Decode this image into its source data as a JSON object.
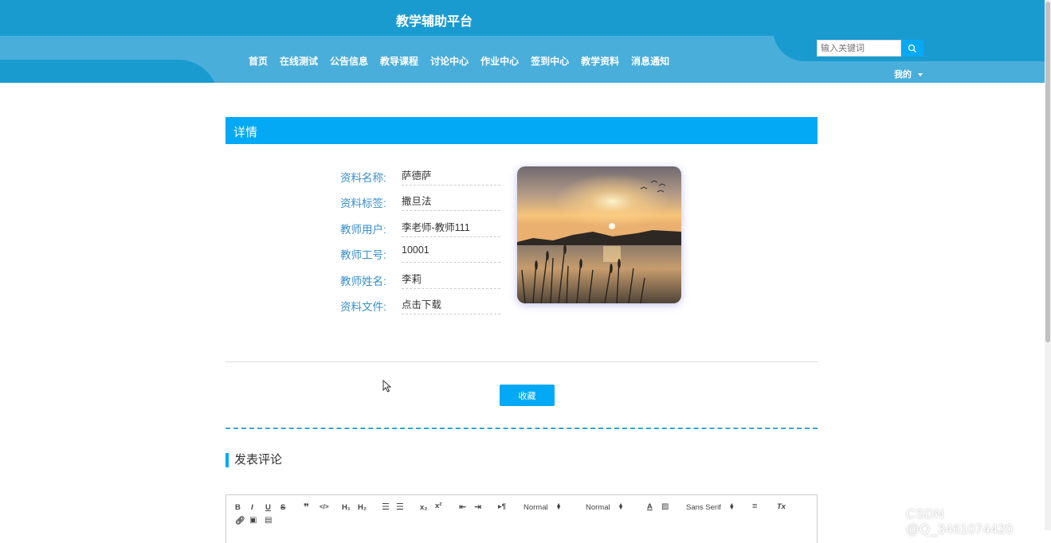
{
  "header": {
    "title": "教学辅助平台",
    "nav": [
      "首页",
      "在线测试",
      "公告信息",
      "教导课程",
      "讨论中心",
      "作业中心",
      "签到中心",
      "教学资料",
      "消息通知"
    ],
    "search_placeholder": "输入关键词",
    "user_menu": "我的"
  },
  "detail": {
    "heading": "详情",
    "fields": [
      {
        "label": "资料名称:",
        "value": "萨德萨"
      },
      {
        "label": "资料标签:",
        "value": "撒旦法"
      },
      {
        "label": "教师用户:",
        "value": "李老师-教师111"
      },
      {
        "label": "教师工号:",
        "value": "10001"
      },
      {
        "label": "教师姓名:",
        "value": "李莉"
      },
      {
        "label": "资料文件:",
        "value": "点击下载"
      }
    ],
    "favorite_button": "收藏"
  },
  "comments": {
    "heading": "发表评论",
    "toolbar": {
      "header_select": "Normal",
      "size_select": "Normal",
      "font_select": "Sans Serif"
    }
  },
  "watermark": "CSDN @Q_3461074420"
}
